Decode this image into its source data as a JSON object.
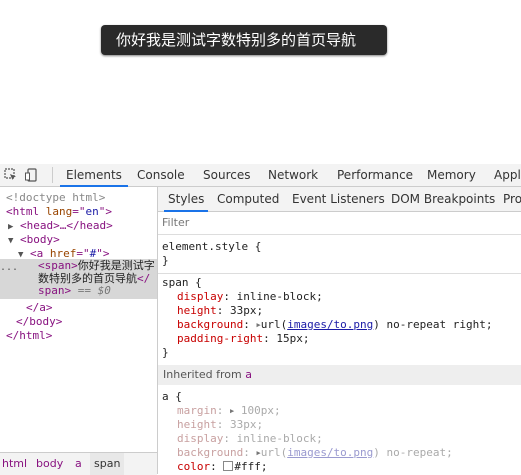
{
  "preview": {
    "button_text": "你好我是测试字数特别多的首页导航"
  },
  "devtools": {
    "main_tabs": [
      "Elements",
      "Console",
      "Sources",
      "Network",
      "Performance",
      "Memory",
      "Appli"
    ],
    "sub_tabs": [
      "Styles",
      "Computed",
      "Event Listeners",
      "DOM Breakpoints",
      "Pro"
    ],
    "filter_placeholder": "Filter"
  },
  "dom": {
    "doctype": "<!doctype html>",
    "html_open_tag": "<html",
    "html_attr": "lang",
    "html_attr_eq": "=\"",
    "html_attr_val": "en",
    "html_attr_close": "\">",
    "head_collapsed": "<head>…</head>",
    "body_open": "<body>",
    "a_open_tag": "<a",
    "a_attr": "href",
    "a_attr_eq": "=\"",
    "a_attr_val": "#",
    "a_attr_close": "\">",
    "span_open": "<span>",
    "span_text": "你好我是测试字数特别多的首页导航",
    "span_close": "</span>",
    "selected_marker": "== $0",
    "dots": "...",
    "a_close": "</a>",
    "body_close": "</body>",
    "html_close": "</html>"
  },
  "breadcrumbs": [
    "html",
    "body",
    "a",
    "span"
  ],
  "styles": {
    "element_style_selector": "element.style {",
    "close_brace": "}",
    "span_selector": "span {",
    "span_props": {
      "display_name": "display",
      "display_value": "inline-block;",
      "height_name": "height",
      "height_value": "33px;",
      "background_name": "background",
      "background_url_prefix": "url(",
      "background_url_link": "images/to.png",
      "background_url_rest": ") no-repeat right;",
      "padding_name": "padding-right",
      "padding_value": "15px;"
    },
    "inherited_label": "Inherited from",
    "inherited_from": "a",
    "a_selector": "a {",
    "a_props": {
      "margin_name": "margin",
      "margin_value": "100px;",
      "height_name": "height",
      "height_value": "33px;",
      "display_name": "display",
      "display_value": "inline-block;",
      "background_name": "background",
      "background_url_prefix": "url(",
      "background_url_link": "images/to.png",
      "background_url_rest": ") no-repeat;",
      "color_name": "color",
      "color_value": "#fff;"
    }
  },
  "colors": {
    "accent": "#1a73e8",
    "tag": "#881280",
    "property": "#c80000",
    "attr_value": "#1a1aa6"
  },
  "icons": {
    "inspect": "inspect-element-icon",
    "device": "device-toolbar-icon"
  }
}
